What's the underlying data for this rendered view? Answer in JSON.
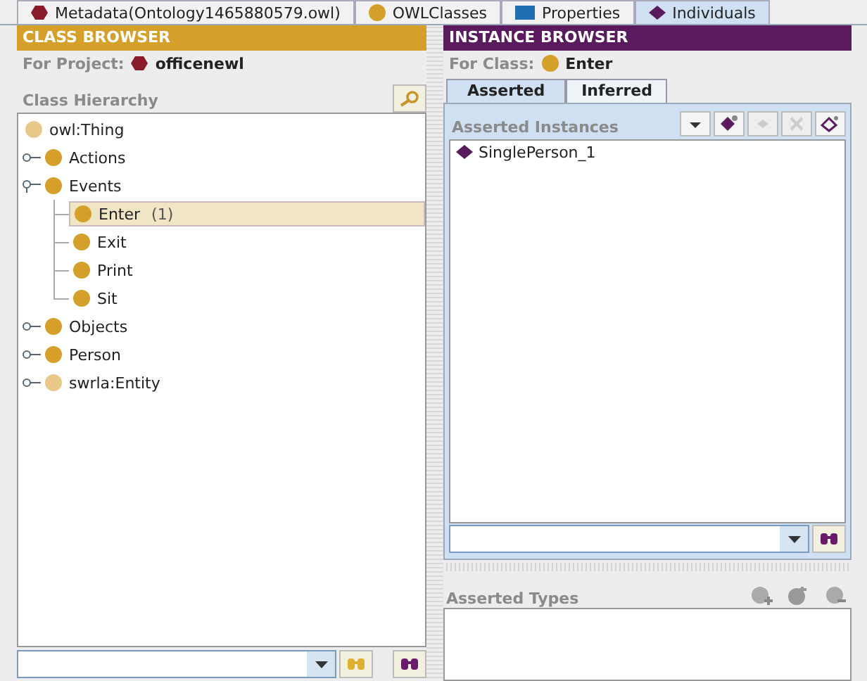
{
  "top_tabs": [
    {
      "label": "Metadata(Ontology1465880579.owl)",
      "kind": "metadata",
      "selected": false
    },
    {
      "label": "OWLClasses",
      "kind": "classes",
      "selected": false
    },
    {
      "label": "Properties",
      "kind": "properties",
      "selected": false
    },
    {
      "label": "Individuals",
      "kind": "individuals",
      "selected": true
    }
  ],
  "class_browser": {
    "title": "CLASS BROWSER",
    "project_label": "For Project:",
    "project": "officenewl",
    "hierarchy_label": "Class Hierarchy",
    "tree": [
      {
        "label": "owl:Thing",
        "color": "#e8c98a",
        "children": [
          {
            "label": "Actions",
            "color": "#d4a02a",
            "expanded": false,
            "selected": false
          },
          {
            "label": "Events",
            "color": "#d4a02a",
            "expanded": true,
            "selected": false,
            "children": [
              {
                "label": "Enter",
                "count": "(1)",
                "color": "#d4a02a",
                "selected": true
              },
              {
                "label": "Exit",
                "color": "#d4a02a",
                "selected": false
              },
              {
                "label": "Print",
                "color": "#d4a02a",
                "selected": false
              },
              {
                "label": "Sit",
                "color": "#d4a02a",
                "selected": false
              }
            ]
          },
          {
            "label": "Objects",
            "color": "#d4a02a",
            "expanded": false,
            "selected": false
          },
          {
            "label": "Person",
            "color": "#d4a02a",
            "expanded": false,
            "selected": false
          },
          {
            "label": "swrla:Entity",
            "color": "#e8c98a",
            "expanded": false,
            "selected": false
          }
        ]
      }
    ]
  },
  "instance_browser": {
    "title": "INSTANCE BROWSER",
    "class_label": "For Class:",
    "class_name": "Enter",
    "tabs": [
      {
        "label": "Asserted",
        "selected": true
      },
      {
        "label": "Inferred",
        "selected": false
      }
    ],
    "instances_label": "Asserted Instances",
    "instances": [
      {
        "label": "SinglePerson_1"
      }
    ],
    "types_label": "Asserted Types"
  }
}
